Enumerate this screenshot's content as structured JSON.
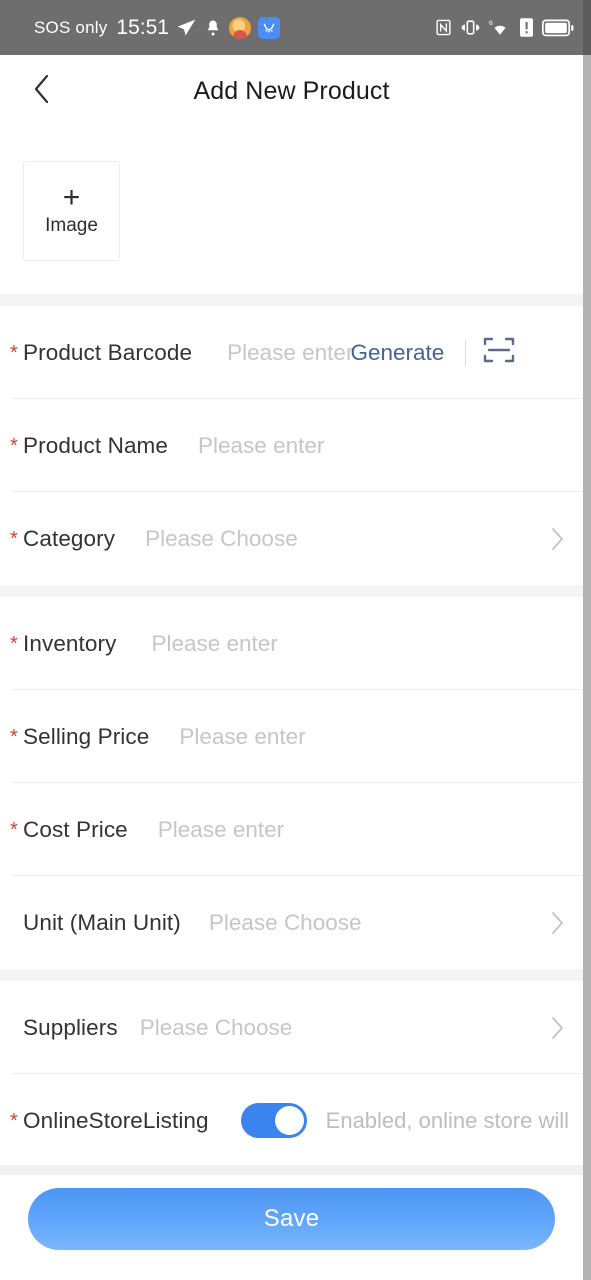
{
  "status_bar": {
    "carrier": "SOS only",
    "time": "15:51",
    "left_icons": [
      "send-icon",
      "bell-icon",
      "app-icon-orange",
      "app-icon-blue"
    ],
    "right_icons": [
      "nfc-icon",
      "vibrate-icon",
      "wifi-6-icon",
      "alert-icon",
      "battery-icon"
    ],
    "background": "#6e6e6e"
  },
  "header": {
    "title": "Add New Product",
    "back_icon": "chevron-left-icon"
  },
  "image_uploader": {
    "plus": "+",
    "label": "Image"
  },
  "form": {
    "barcode": {
      "required": "*",
      "label": "Product Barcode",
      "placeholder": "Please enter",
      "generate_label": "Generate",
      "scan_icon": "barcode-scan-icon"
    },
    "product_name": {
      "required": "*",
      "label": "Product Name",
      "placeholder": "Please enter"
    },
    "category": {
      "required": "*",
      "label": "Category",
      "placeholder": "Please Choose",
      "chevron": "chevron-right-icon"
    },
    "inventory": {
      "required": "*",
      "label": "Inventory",
      "placeholder": "Please enter"
    },
    "selling_price": {
      "required": "*",
      "label": "Selling Price",
      "placeholder": "Please enter"
    },
    "cost_price": {
      "required": "*",
      "label": "Cost Price",
      "placeholder": "Please enter"
    },
    "unit": {
      "label": "Unit (Main Unit)",
      "placeholder": "Please Choose",
      "chevron": "chevron-right-icon"
    },
    "suppliers": {
      "label": "Suppliers",
      "placeholder": "Please Choose",
      "chevron": "chevron-right-icon"
    },
    "online_store_listing": {
      "required": "*",
      "label": "OnlineStoreListing",
      "toggle_state": "on",
      "hint": "Enabled, online store will"
    }
  },
  "footer": {
    "save_label": "Save"
  },
  "colors": {
    "required_star": "#e23c31",
    "link_blue": "#456498",
    "toggle_on": "#3b84f0",
    "save_gradient_top": "#4d95f4",
    "save_gradient_bottom": "#7ab6fd",
    "status_bar_bg": "#6e6e6e",
    "placeholder": "#c6c6c8"
  }
}
